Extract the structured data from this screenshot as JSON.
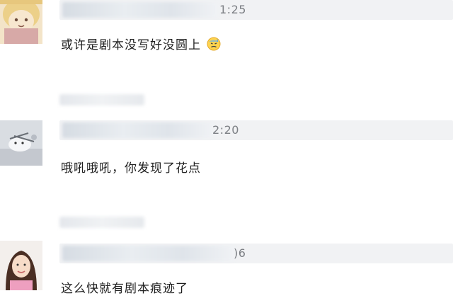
{
  "comments": [
    {
      "time_fragment": "1:25",
      "text": "或许是剧本没写好没圆上",
      "emoji": "sweat-face-icon"
    },
    {
      "time_fragment": "2:20",
      "text": "哦吼哦吼，你发现了花点"
    },
    {
      "time_fragment": ")6",
      "text": "这么快就有剧本痕迹了"
    }
  ]
}
